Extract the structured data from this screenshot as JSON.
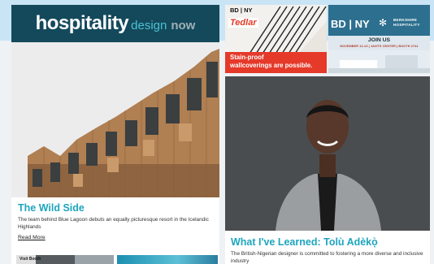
{
  "header": {
    "logo_main": "hospitality",
    "logo_sub": "design",
    "logo_now": "now"
  },
  "feature_left": {
    "title": "The Wild Side",
    "summary": "The team behind Blue Lagoon debuts an equally picturesque resort in the Icelandic Highlands",
    "read_more": "Read More"
  },
  "preview": {
    "thumb_label": "Visit Booth"
  },
  "ad_tedlar": {
    "event": "BD | NY",
    "brand": "Tedlar",
    "tagline_line1": "Stain-proof",
    "tagline_line2": "wallcoverings are possible."
  },
  "ad_berkshire": {
    "event": "BD | NY",
    "partner_line1": "BERKSHIRE",
    "partner_line2": "HOSPITALITY",
    "cta": "JOIN US",
    "dates": "NOVEMBER 12-13 | JAVITS CENTER | BOOTH 2741"
  },
  "feature_right": {
    "title": "What I've Learned: Tolù Adèkọ̀",
    "summary": "The British-Nigerian designer is committed to fostering a more diverse and inclusive industry"
  },
  "colors": {
    "header_bg": "#14495c",
    "accent": "#1ea5bd",
    "ad_red": "#e5392a",
    "ad_blue": "#2d6f8f"
  }
}
